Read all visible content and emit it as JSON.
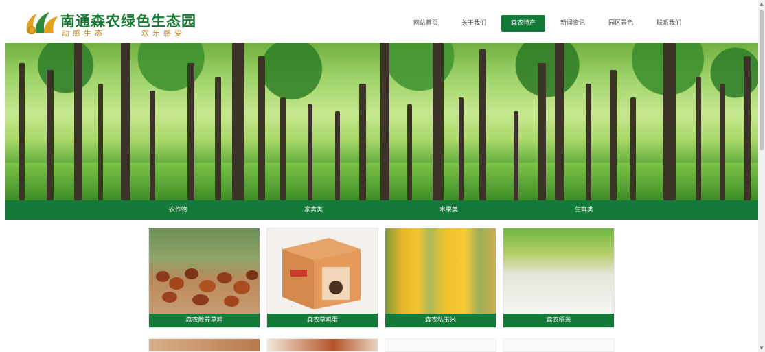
{
  "brand": {
    "title": "南通森农绿色生态园",
    "slogan_left": "动感生态",
    "slogan_right": "欢乐感受",
    "colors": {
      "green": "#147a3a",
      "gold": "#c9861a"
    }
  },
  "nav": {
    "items": [
      {
        "label": "网站首页"
      },
      {
        "label": "关于我们"
      },
      {
        "label": "森农特产",
        "active": true
      },
      {
        "label": "新闻资讯"
      },
      {
        "label": "园区景色"
      },
      {
        "label": "联系我们"
      }
    ]
  },
  "categories": [
    {
      "label": "农作物"
    },
    {
      "label": "家禽类"
    },
    {
      "label": "水果类"
    },
    {
      "label": "生鲜类"
    }
  ],
  "products": [
    {
      "label": "森农散养草鸡"
    },
    {
      "label": "森农草鸡蛋"
    },
    {
      "label": "森农粘玉米"
    },
    {
      "label": "森农稻米"
    }
  ],
  "icons": {
    "scroll_up": "scroll-up-icon",
    "scroll_down": "scroll-down-icon"
  }
}
